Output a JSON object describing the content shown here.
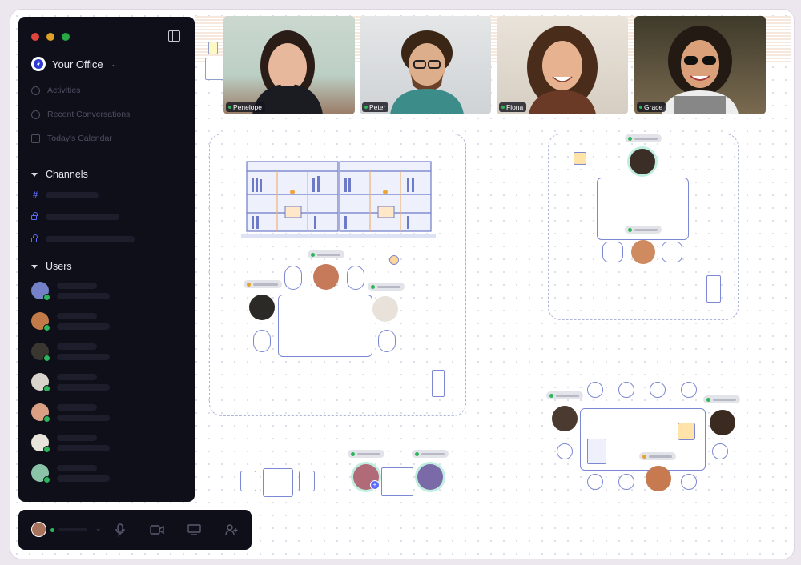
{
  "app": {
    "office_name": "Your Office"
  },
  "nav": [
    {
      "label": "Activities",
      "icon": "refresh-icon"
    },
    {
      "label": "Recent Conversations",
      "icon": "clock-icon"
    },
    {
      "label": "Today's Calendar",
      "icon": "calendar-icon"
    }
  ],
  "sections": {
    "channels": "Channels",
    "users": "Users"
  },
  "video": [
    {
      "name": "Penelope"
    },
    {
      "name": "Peter"
    },
    {
      "name": "Fiona"
    },
    {
      "name": "Grace"
    }
  ],
  "colors": {
    "accent": "#5b6cff",
    "online": "#2cb55a",
    "away": "#e3a22b",
    "sidebar": "#0f0f1a"
  },
  "toolbar_icons": [
    "microphone-icon",
    "camera-icon",
    "screen-share-icon",
    "add-user-icon"
  ]
}
